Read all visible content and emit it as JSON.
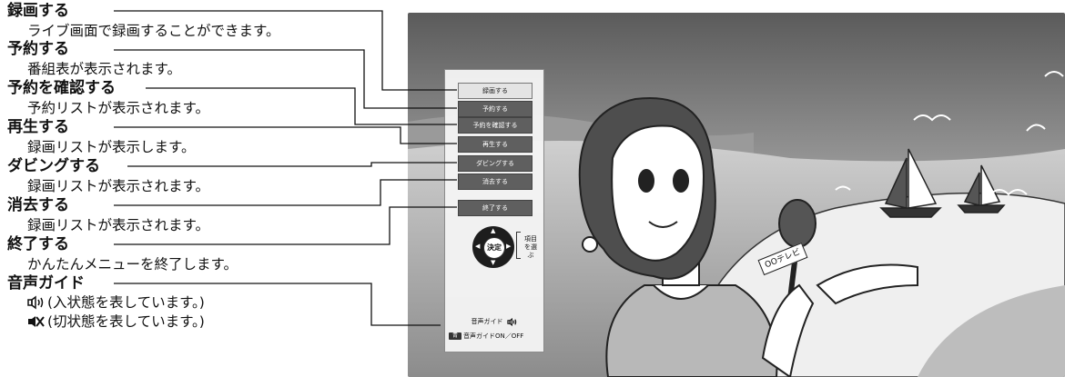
{
  "legend": [
    {
      "title": "録画する",
      "desc": "ライブ画面で録画することができます。"
    },
    {
      "title": "予約する",
      "desc": "番組表が表示されます。"
    },
    {
      "title": "予約を確認する",
      "desc": "予約リストが表示されます。"
    },
    {
      "title": "再生する",
      "desc": "録画リストが表示します。"
    },
    {
      "title": "ダビングする",
      "desc": "録画リストが表示されます。"
    },
    {
      "title": "消去する",
      "desc": "録画リストが表示されます。"
    },
    {
      "title": "終了する",
      "desc": "かんたんメニューを終了します。"
    },
    {
      "title": "音声ガイド",
      "on_desc": "(入状態を表しています。)",
      "off_desc": "(切状態を表しています。)"
    }
  ],
  "menu": {
    "items": [
      "録画する",
      "予約する",
      "予約を確認する",
      "再生する",
      "ダビングする",
      "消去する",
      "終了する"
    ],
    "selected_index": 0,
    "dpad_center": "決定",
    "dpad_hint": "項目を選ぶ",
    "audio_guide_label": "音声ガイド",
    "audio_guide_toggle_key": "青",
    "audio_guide_toggle_label": "音声ガイドON／OFF"
  },
  "scene": {
    "mic_label": "OOテレビ"
  },
  "colors": {
    "button_dark": "#5f5f5f",
    "button_selected": "#e4e4e4",
    "panel_bg": "#f4f4f4",
    "line": "#111111"
  },
  "icons": {
    "audio_on": "speaker-on-icon",
    "audio_off": "speaker-off-icon"
  }
}
